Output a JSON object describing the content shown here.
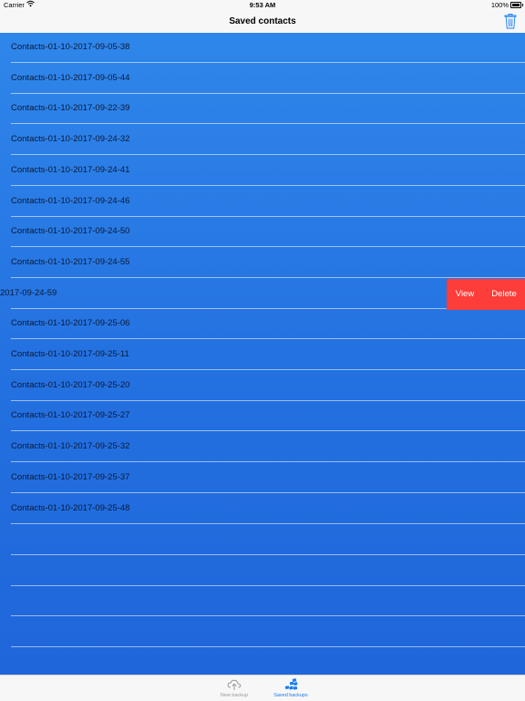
{
  "status_bar": {
    "carrier": "Carrier",
    "time": "9:53 AM",
    "battery": "100%"
  },
  "nav": {
    "title": "Saved contacts",
    "trash_icon": "trash-icon"
  },
  "rows": [
    {
      "label": "Contacts-01-10-2017-09-05-38"
    },
    {
      "label": "Contacts-01-10-2017-09-05-44"
    },
    {
      "label": "Contacts-01-10-2017-09-22-39"
    },
    {
      "label": "Contacts-01-10-2017-09-24-32"
    },
    {
      "label": "Contacts-01-10-2017-09-24-41"
    },
    {
      "label": "Contacts-01-10-2017-09-24-46"
    },
    {
      "label": "Contacts-01-10-2017-09-24-50"
    },
    {
      "label": "Contacts-01-10-2017-09-24-55"
    },
    {
      "label": "2017-09-24-59",
      "swiped": true
    },
    {
      "label": "Contacts-01-10-2017-09-25-06"
    },
    {
      "label": "Contacts-01-10-2017-09-25-11"
    },
    {
      "label": "Contacts-01-10-2017-09-25-20"
    },
    {
      "label": "Contacts-01-10-2017-09-25-27"
    },
    {
      "label": "Contacts-01-10-2017-09-25-32"
    },
    {
      "label": "Contacts-01-10-2017-09-25-37"
    },
    {
      "label": "Contacts-01-10-2017-09-25-48"
    }
  ],
  "swipe_actions": {
    "view": "View",
    "delete": "Delete"
  },
  "tabs": [
    {
      "label": "New backup",
      "icon": "cloud-icon",
      "active": false
    },
    {
      "label": "Saved backups",
      "icon": "stack-icon",
      "active": true
    }
  ],
  "colors": {
    "accent": "#1a7cf5",
    "delete_red": "#fc3d39",
    "list_blue": "#2370e0",
    "tab_inactive": "#9a9a9a"
  }
}
